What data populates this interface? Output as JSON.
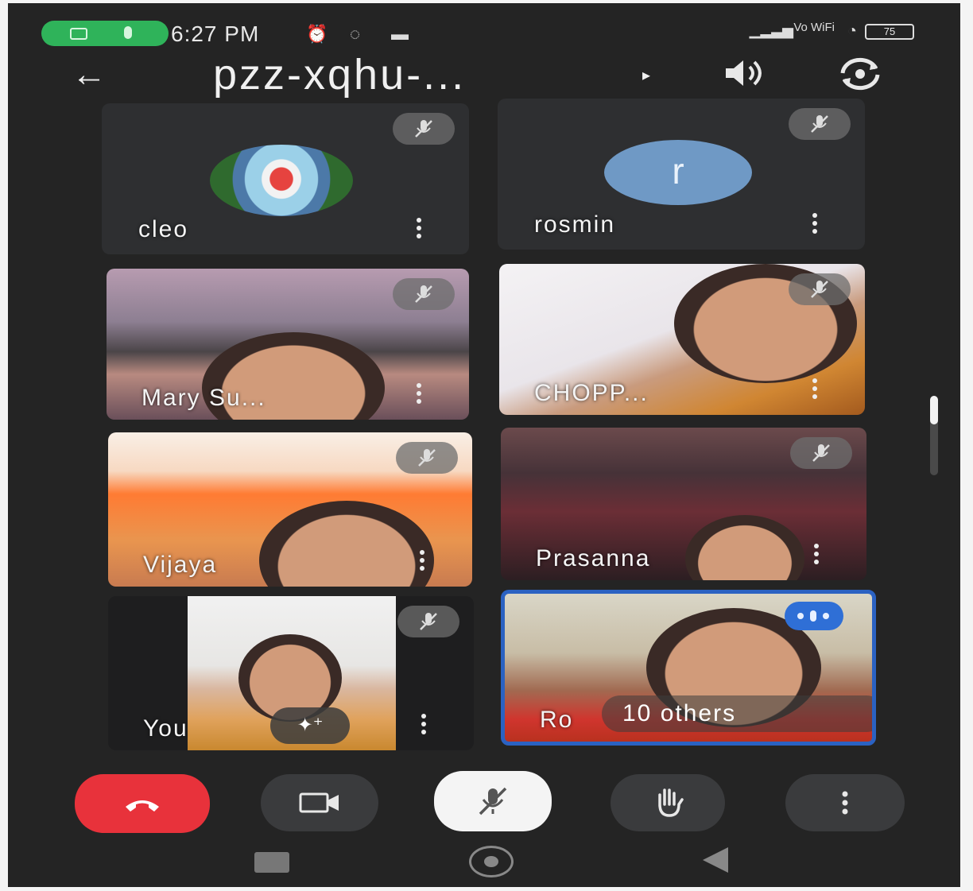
{
  "status_bar": {
    "time": "6:27 PM",
    "network": "Vo WiFi",
    "battery": "75"
  },
  "header": {
    "back_icon": "arrow-left-icon",
    "meeting_code": "pzz-xqhu-...",
    "speaker_icon": "speaker-icon",
    "switch_camera_icon": "switch-camera-icon"
  },
  "participants": [
    {
      "name": "cleo",
      "muted": true,
      "video": false,
      "avatar": "photo"
    },
    {
      "name": "rosmin",
      "muted": true,
      "video": false,
      "avatar_letter": "r"
    },
    {
      "name": "Mary Su...",
      "muted": true,
      "video": true
    },
    {
      "name": "CHOPP...",
      "muted": true,
      "video": true
    },
    {
      "name": "Vijaya",
      "muted": true,
      "video": true
    },
    {
      "name": "Prasanna",
      "muted": true,
      "video": true
    },
    {
      "name": "You",
      "muted": true,
      "video": true,
      "effects_label": "✦⁺"
    },
    {
      "name": "Ro",
      "muted": false,
      "video": true,
      "speaking": true,
      "others_label": "10 others"
    }
  ],
  "controls": {
    "end_call_icon": "end-call-icon",
    "camera_icon": "camera-icon",
    "mic_icon": "mic-off-icon",
    "hand_icon": "raise-hand-icon",
    "more_icon": "more-vertical-icon"
  },
  "colors": {
    "background": "#242424",
    "end_call": "#e8323b",
    "active_speaker_border": "#2b62c2",
    "status_pill": "#2fb35a"
  }
}
